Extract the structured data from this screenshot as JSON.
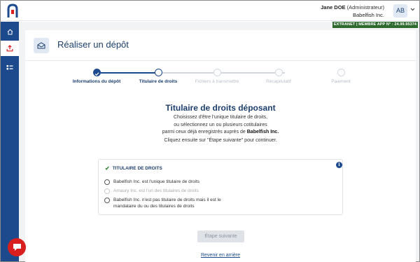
{
  "header": {
    "user_name": "Jane DOE",
    "user_role": "(Administrateur)",
    "company": "Babelfish Inc.",
    "avatar_initials": "AB",
    "extranet_badge": "EXTRANET | MEMBRE APP N° : 24.99.95374"
  },
  "sidebar": {
    "items": [
      {
        "icon": "home-icon",
        "active": false
      },
      {
        "icon": "upload-icon",
        "active": true
      },
      {
        "icon": "list-icon",
        "active": false
      }
    ]
  },
  "page": {
    "title": "Réaliser un dépôt"
  },
  "stepper": {
    "steps": [
      {
        "label": "Informations du dépôt",
        "state": "done"
      },
      {
        "label": "Titulaire de droits",
        "state": "current"
      },
      {
        "label": "Fichiers à transmettre",
        "state": "todo"
      },
      {
        "label": "Récapitulatif",
        "state": "todo"
      },
      {
        "label": "Paiement",
        "state": "todo"
      }
    ]
  },
  "main": {
    "title": "Titulaire de droits déposant",
    "desc_line1": "Choisissez d'être l'unique titulaire de droits,",
    "desc_line2": "ou sélectionnez un ou plusieurs cotitulaires",
    "desc_line3_prefix": "parmi ceux déjà enregistrés auprès de ",
    "desc_line3_company": "Babelfish Inc.",
    "hint": "Cliquez ensuite sur \"Étape suivante\" pour continuer."
  },
  "options": {
    "title": "TITULAIRE DE DROITS",
    "items": [
      {
        "label": "Babelfish Inc. est l'unique titulaire de droits",
        "disabled": false
      },
      {
        "label": "Amaury Inc. est l'un des titulaires de droits",
        "disabled": true
      },
      {
        "label_line1": "Babelfish Inc. n'est pas titulaire de droits mais il est le",
        "label_line2": "mandataire du ou des titulaires de droits",
        "disabled": false
      }
    ]
  },
  "actions": {
    "next_label": "Étape suivante",
    "back_label": "Revenir en arrière"
  },
  "colors": {
    "primary": "#1d4a8c",
    "title": "#1d3f6e",
    "banner": "#2e6a2e",
    "chat": "#d91e1e"
  }
}
